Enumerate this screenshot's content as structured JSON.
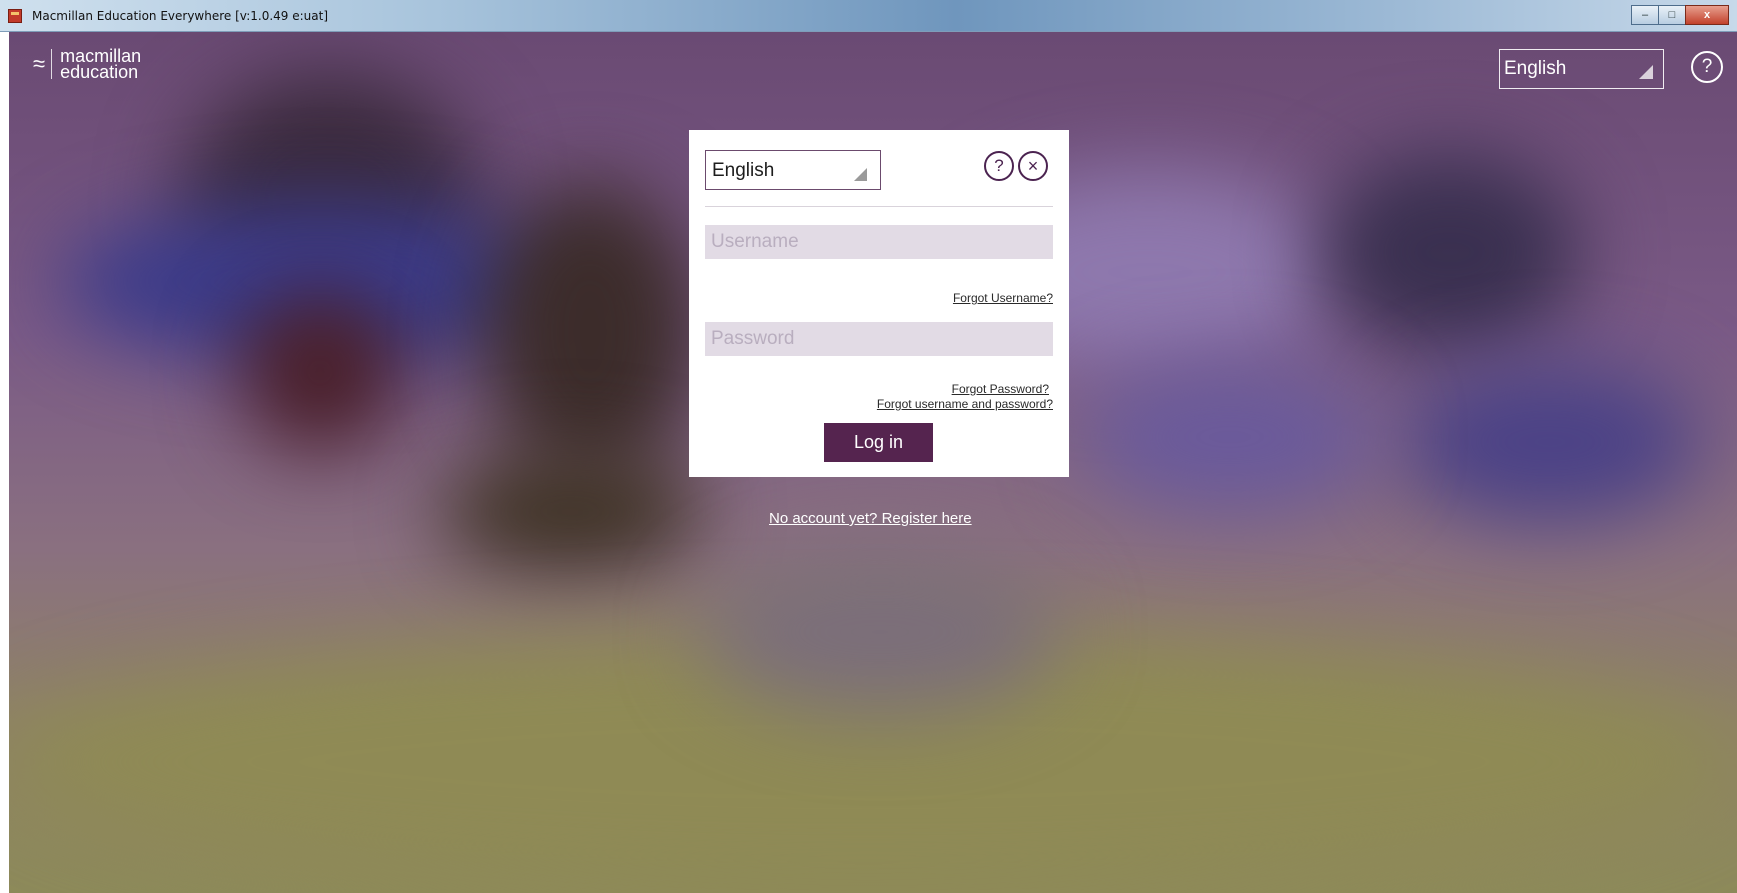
{
  "window": {
    "title": "Macmillan Education Everywhere [v:1.0.49 e:uat]",
    "icon": "app-icon",
    "controls": {
      "minimize": "–",
      "maximize": "□",
      "close": "x"
    }
  },
  "header": {
    "logo": {
      "line1": "macmillan",
      "line2": "education",
      "icon": "macmillan-logo-icon"
    },
    "language_select": {
      "value": "English"
    },
    "help_label": "?"
  },
  "login_dialog": {
    "language_select": {
      "value": "English"
    },
    "help_label": "?",
    "close_label": "×",
    "username": {
      "placeholder": "Username",
      "value": ""
    },
    "forgot_username": "Forgot Username?",
    "password": {
      "placeholder": "Password",
      "value": ""
    },
    "forgot_password": "Forgot Password?",
    "forgot_both": "Forgot username and password?",
    "login_button": "Log in"
  },
  "register_link": "No account yet? Register here",
  "colors": {
    "brand_purple": "#55244f",
    "field_bg": "#e2dbe5"
  }
}
